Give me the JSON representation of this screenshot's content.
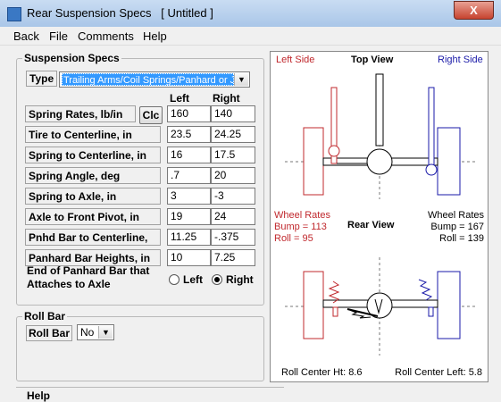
{
  "window": {
    "title": "Rear Suspension Specs   [ Untitled ]",
    "close_label": "X"
  },
  "menu": {
    "back": "Back",
    "file": "File",
    "comments": "Comments",
    "help": "Help"
  },
  "specs": {
    "group_title": "Suspension Specs",
    "type_label": "Type",
    "type_value": "Trailing Arms/Coil Springs/Panhard or J B",
    "col_left": "Left",
    "col_right": "Right",
    "calc_button": "Clc",
    "rows": [
      {
        "label": "Spring Rates, lb/in",
        "left": "160",
        "right": "140"
      },
      {
        "label": "Tire to Centerline, in",
        "left": "23.5",
        "right": "24.25"
      },
      {
        "label": "Spring to Centerline, in",
        "left": "16",
        "right": "17.5"
      },
      {
        "label": "Spring Angle, deg",
        "left": ".7",
        "right": "20"
      },
      {
        "label": "Spring to Axle, in",
        "left": "3",
        "right": "-3"
      },
      {
        "label": "Axle to Front Pivot, in",
        "left": "19",
        "right": "24"
      },
      {
        "label": "Pnhd Bar to Centerline, in",
        "left": "11.25",
        "right": "-.375"
      },
      {
        "label": "Panhard Bar Heights, in",
        "left": "10",
        "right": "7.25"
      }
    ],
    "panhard_end_question_line1": "End of Panhard Bar that",
    "panhard_end_question_line2": "Attaches to Axle",
    "radio_left": "Left",
    "radio_right": "Right",
    "radio_selected": "Right"
  },
  "roll_bar": {
    "group_title": "Roll Bar",
    "label": "Roll Bar",
    "value": "No"
  },
  "views": {
    "left_side": "Left Side",
    "top_view": "Top View",
    "right_side": "Right Side",
    "left_wheel_rates": "Wheel Rates",
    "left_bump": "Bump = 113",
    "left_roll": "Roll = 95",
    "rear_view": "Rear View",
    "right_wheel_rates": "Wheel Rates",
    "right_bump": "Bump = 167",
    "right_roll": "Roll = 139",
    "roll_center_ht": "Roll Center Ht: 8.6",
    "roll_center_left": "Roll Center Left: 5.8"
  },
  "bottom_group_title": "Help",
  "colors": {
    "left_side": "#c0282d",
    "right_side": "#1a1aa8",
    "selection": "#3399ff"
  }
}
